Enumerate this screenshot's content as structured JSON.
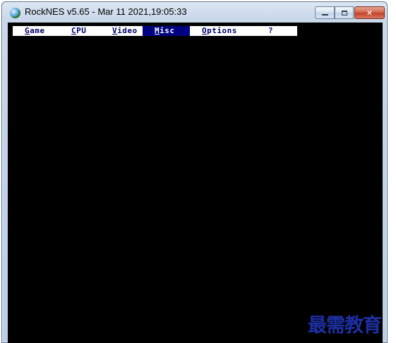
{
  "window": {
    "title": "RockNES v5.65 - Mar 11 2021,19:05:33"
  },
  "menu": {
    "items": [
      {
        "accel": "G",
        "rest": "ame"
      },
      {
        "accel": "C",
        "rest": "PU"
      },
      {
        "accel": "V",
        "rest": "ideo"
      },
      {
        "accel": "M",
        "rest": "isc"
      },
      {
        "accel": "O",
        "rest": "ptions"
      },
      {
        "accel": "",
        "rest": "?"
      }
    ],
    "active_index": 3
  },
  "watermark": {
    "text": "最需教育"
  },
  "icons": {
    "app": "rocknes-globe-icon",
    "minimize": "minimize-icon",
    "maximize": "maximize-icon",
    "close": "close-icon"
  },
  "colors": {
    "client_background": "#000000",
    "menu_background": "#ffffff",
    "menu_text": "#000066",
    "menu_active_background": "#000080",
    "watermark": "#1d2fa4",
    "close_button": "#c3412a"
  }
}
